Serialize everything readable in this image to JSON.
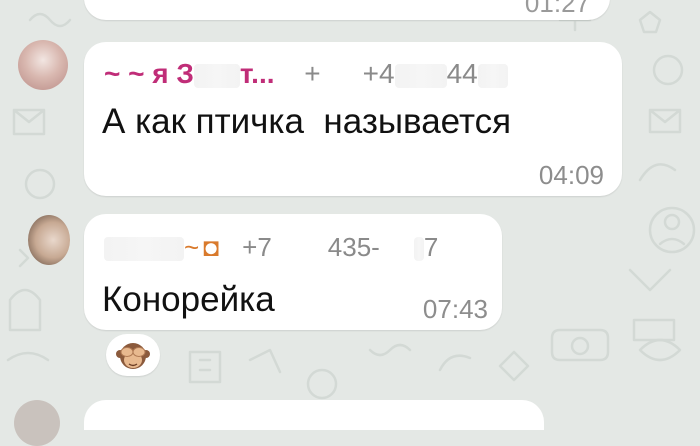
{
  "previous_message": {
    "time": "01:27"
  },
  "messages": [
    {
      "sender_name": "~ ~ я З",
      "sender_name_tail": "т...",
      "sender_phone_parts": [
        "+",
        "+4",
        "44"
      ],
      "text": "А как птичка  называется",
      "time": "04:09"
    },
    {
      "sender_name": "~",
      "sender_phone_parts": [
        "+7",
        "435-",
        "7"
      ],
      "text": "Конорейка",
      "time": "07:43",
      "reaction": "see-no-evil-monkey"
    }
  ],
  "colors": {
    "wallpaper": "#e4e8e5",
    "bubble": "#ffffff",
    "sender_name": "#c02d78",
    "timestamp": "#8d8d8d"
  }
}
